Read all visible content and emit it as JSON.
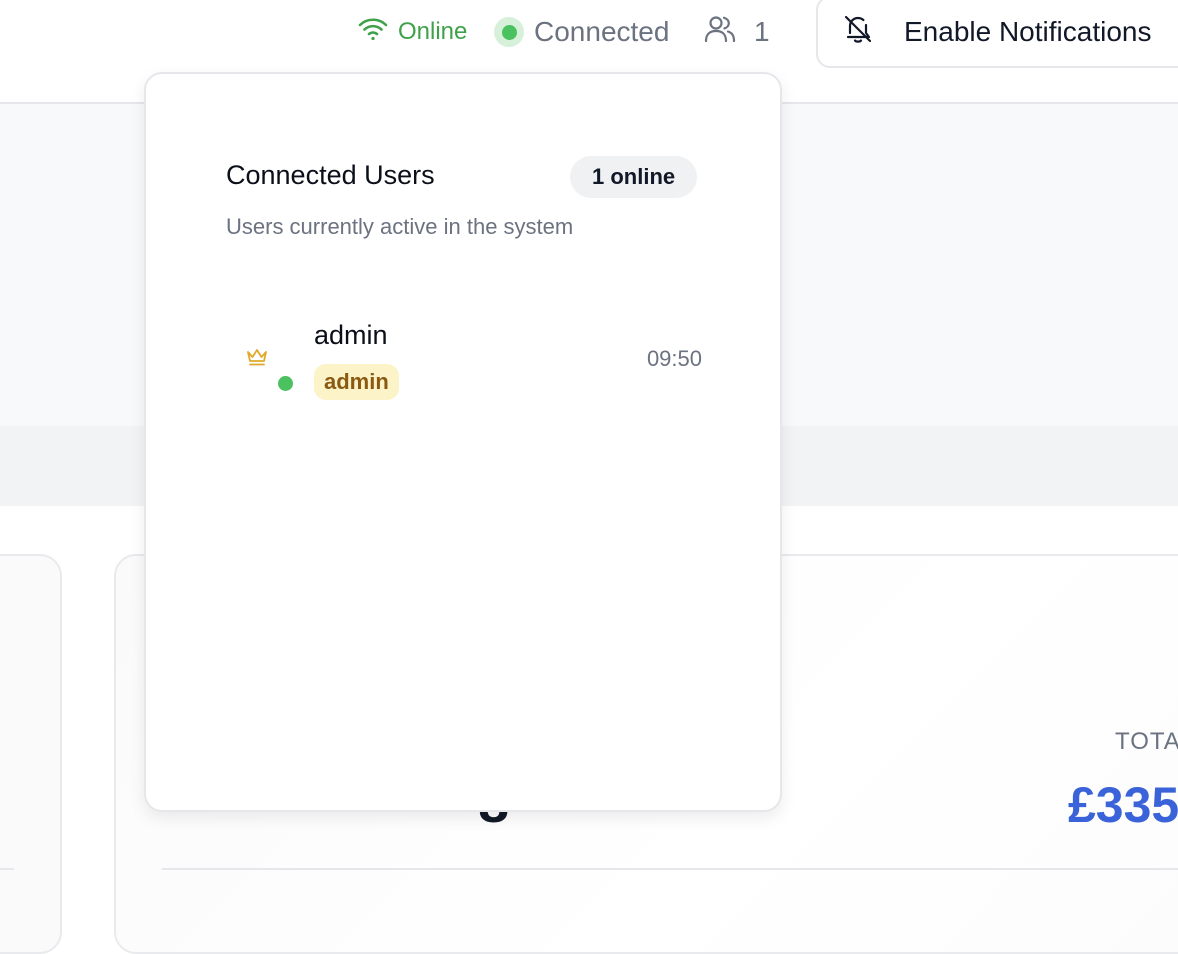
{
  "header": {
    "online_label": "Online",
    "connected_label": "Connected",
    "users_count": "1",
    "notifications_label": "Enable Notifications"
  },
  "popover": {
    "title": "Connected Users",
    "badge": "1 online",
    "subtitle": "Users currently active in the system",
    "users": [
      {
        "name": "admin",
        "role": "admin",
        "time": "09:50",
        "role_icon": "crown-icon",
        "status": "online"
      }
    ]
  },
  "dashboard": {
    "total_label": "TOTA",
    "total_value": "£335",
    "partial_digit": "8"
  },
  "colors": {
    "online": "#3fa14a",
    "status_dot": "#4cc160",
    "accent_blue": "#3b63d9",
    "admin_badge_bg": "#fdf3c8",
    "admin_badge_text": "#8a5a12",
    "crown": "#e0a92a"
  }
}
